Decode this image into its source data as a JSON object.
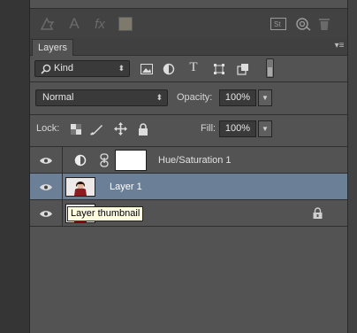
{
  "toolbar": {
    "icons": [
      "warp-text-icon",
      "text-icon",
      "fx-icon",
      "color-swatch-icon",
      "sample-swatch-icon",
      "cloud-sync-icon",
      "trash-icon"
    ]
  },
  "panel": {
    "tab_label": "Layers",
    "filter": {
      "kind_label": "Kind",
      "icons": [
        "image-filter-icon",
        "adjustment-filter-icon",
        "type-filter-icon",
        "shape-filter-icon",
        "smart-object-filter-icon"
      ]
    },
    "blend": {
      "mode": "Normal",
      "opacity_label": "Opacity:",
      "opacity_value": "100%"
    },
    "lock": {
      "label": "Lock:",
      "fill_label": "Fill:",
      "fill_value": "100%"
    },
    "layers": [
      {
        "name": "Hue/Saturation 1",
        "type": "adjustment",
        "selected": false
      },
      {
        "name": "Layer 1",
        "type": "pixel",
        "selected": true
      },
      {
        "name": "",
        "type": "background",
        "selected": false,
        "locked": true
      }
    ],
    "tooltip": "Layer thumbnail"
  },
  "colors": {
    "panel_bg": "#535353",
    "selected_row": "#6b7f97",
    "tooltip_bg": "#fffde0"
  }
}
